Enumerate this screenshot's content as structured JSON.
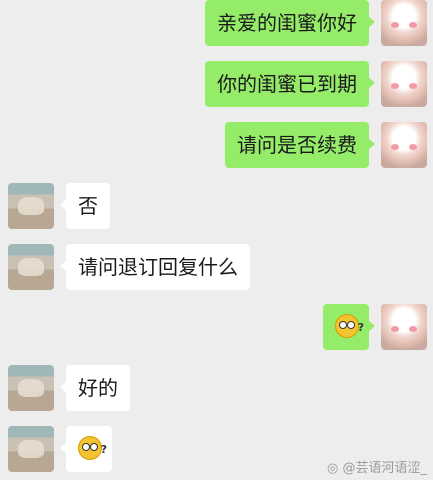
{
  "messages": [
    {
      "side": "me",
      "text": "亲爱的闺蜜你好"
    },
    {
      "side": "me",
      "text": "你的闺蜜已到期"
    },
    {
      "side": "me",
      "text": "请问是否续费"
    },
    {
      "side": "other",
      "text": "否"
    },
    {
      "side": "other",
      "text": "请问退订回复什么"
    },
    {
      "side": "me",
      "sticker": "confused-face-emoji"
    },
    {
      "side": "other",
      "text": "好的"
    },
    {
      "side": "other",
      "sticker": "confused-face-emoji"
    }
  ],
  "emoji_mark": "?",
  "watermark": "@芸语河语涩_",
  "colors": {
    "background": "#ededed",
    "my_bubble": "#95ec69",
    "other_bubble": "#ffffff"
  }
}
